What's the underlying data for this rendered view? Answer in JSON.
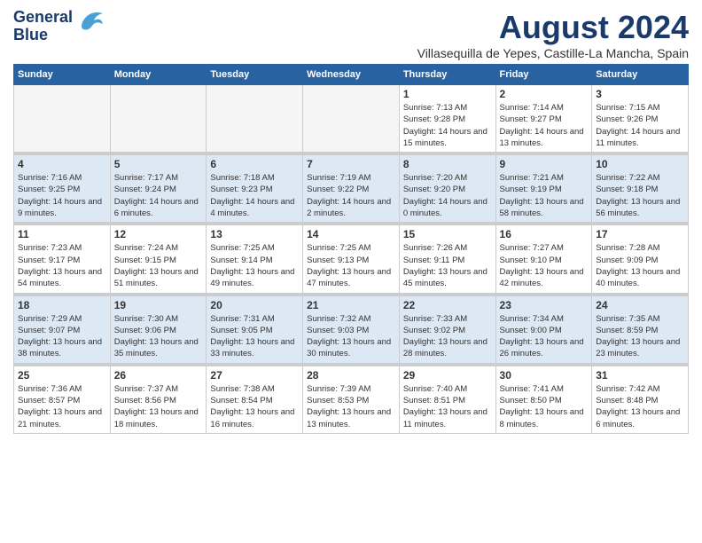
{
  "header": {
    "logo_line1": "General",
    "logo_line2": "Blue",
    "month_year": "August 2024",
    "location": "Villasequilla de Yepes, Castille-La Mancha, Spain"
  },
  "days_of_week": [
    "Sunday",
    "Monday",
    "Tuesday",
    "Wednesday",
    "Thursday",
    "Friday",
    "Saturday"
  ],
  "weeks": [
    {
      "days": [
        {
          "num": "",
          "data": ""
        },
        {
          "num": "",
          "data": ""
        },
        {
          "num": "",
          "data": ""
        },
        {
          "num": "",
          "data": ""
        },
        {
          "num": "1",
          "data": "Sunrise: 7:13 AM\nSunset: 9:28 PM\nDaylight: 14 hours and 15 minutes."
        },
        {
          "num": "2",
          "data": "Sunrise: 7:14 AM\nSunset: 9:27 PM\nDaylight: 14 hours and 13 minutes."
        },
        {
          "num": "3",
          "data": "Sunrise: 7:15 AM\nSunset: 9:26 PM\nDaylight: 14 hours and 11 minutes."
        }
      ]
    },
    {
      "days": [
        {
          "num": "4",
          "data": "Sunrise: 7:16 AM\nSunset: 9:25 PM\nDaylight: 14 hours and 9 minutes."
        },
        {
          "num": "5",
          "data": "Sunrise: 7:17 AM\nSunset: 9:24 PM\nDaylight: 14 hours and 6 minutes."
        },
        {
          "num": "6",
          "data": "Sunrise: 7:18 AM\nSunset: 9:23 PM\nDaylight: 14 hours and 4 minutes."
        },
        {
          "num": "7",
          "data": "Sunrise: 7:19 AM\nSunset: 9:22 PM\nDaylight: 14 hours and 2 minutes."
        },
        {
          "num": "8",
          "data": "Sunrise: 7:20 AM\nSunset: 9:20 PM\nDaylight: 14 hours and 0 minutes."
        },
        {
          "num": "9",
          "data": "Sunrise: 7:21 AM\nSunset: 9:19 PM\nDaylight: 13 hours and 58 minutes."
        },
        {
          "num": "10",
          "data": "Sunrise: 7:22 AM\nSunset: 9:18 PM\nDaylight: 13 hours and 56 minutes."
        }
      ]
    },
    {
      "days": [
        {
          "num": "11",
          "data": "Sunrise: 7:23 AM\nSunset: 9:17 PM\nDaylight: 13 hours and 54 minutes."
        },
        {
          "num": "12",
          "data": "Sunrise: 7:24 AM\nSunset: 9:15 PM\nDaylight: 13 hours and 51 minutes."
        },
        {
          "num": "13",
          "data": "Sunrise: 7:25 AM\nSunset: 9:14 PM\nDaylight: 13 hours and 49 minutes."
        },
        {
          "num": "14",
          "data": "Sunrise: 7:25 AM\nSunset: 9:13 PM\nDaylight: 13 hours and 47 minutes."
        },
        {
          "num": "15",
          "data": "Sunrise: 7:26 AM\nSunset: 9:11 PM\nDaylight: 13 hours and 45 minutes."
        },
        {
          "num": "16",
          "data": "Sunrise: 7:27 AM\nSunset: 9:10 PM\nDaylight: 13 hours and 42 minutes."
        },
        {
          "num": "17",
          "data": "Sunrise: 7:28 AM\nSunset: 9:09 PM\nDaylight: 13 hours and 40 minutes."
        }
      ]
    },
    {
      "days": [
        {
          "num": "18",
          "data": "Sunrise: 7:29 AM\nSunset: 9:07 PM\nDaylight: 13 hours and 38 minutes."
        },
        {
          "num": "19",
          "data": "Sunrise: 7:30 AM\nSunset: 9:06 PM\nDaylight: 13 hours and 35 minutes."
        },
        {
          "num": "20",
          "data": "Sunrise: 7:31 AM\nSunset: 9:05 PM\nDaylight: 13 hours and 33 minutes."
        },
        {
          "num": "21",
          "data": "Sunrise: 7:32 AM\nSunset: 9:03 PM\nDaylight: 13 hours and 30 minutes."
        },
        {
          "num": "22",
          "data": "Sunrise: 7:33 AM\nSunset: 9:02 PM\nDaylight: 13 hours and 28 minutes."
        },
        {
          "num": "23",
          "data": "Sunrise: 7:34 AM\nSunset: 9:00 PM\nDaylight: 13 hours and 26 minutes."
        },
        {
          "num": "24",
          "data": "Sunrise: 7:35 AM\nSunset: 8:59 PM\nDaylight: 13 hours and 23 minutes."
        }
      ]
    },
    {
      "days": [
        {
          "num": "25",
          "data": "Sunrise: 7:36 AM\nSunset: 8:57 PM\nDaylight: 13 hours and 21 minutes."
        },
        {
          "num": "26",
          "data": "Sunrise: 7:37 AM\nSunset: 8:56 PM\nDaylight: 13 hours and 18 minutes."
        },
        {
          "num": "27",
          "data": "Sunrise: 7:38 AM\nSunset: 8:54 PM\nDaylight: 13 hours and 16 minutes."
        },
        {
          "num": "28",
          "data": "Sunrise: 7:39 AM\nSunset: 8:53 PM\nDaylight: 13 hours and 13 minutes."
        },
        {
          "num": "29",
          "data": "Sunrise: 7:40 AM\nSunset: 8:51 PM\nDaylight: 13 hours and 11 minutes."
        },
        {
          "num": "30",
          "data": "Sunrise: 7:41 AM\nSunset: 8:50 PM\nDaylight: 13 hours and 8 minutes."
        },
        {
          "num": "31",
          "data": "Sunrise: 7:42 AM\nSunset: 8:48 PM\nDaylight: 13 hours and 6 minutes."
        }
      ]
    }
  ]
}
